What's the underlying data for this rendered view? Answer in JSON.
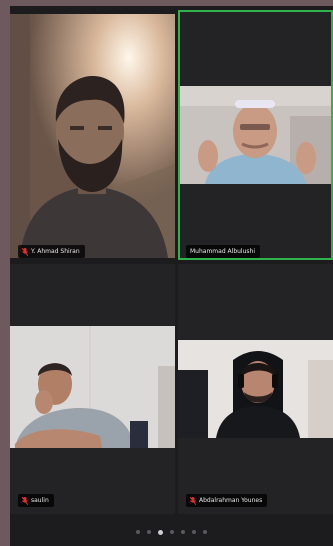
{
  "participants": [
    {
      "name": "Y. Ahmad Shiran",
      "muted": true
    },
    {
      "name": "Muhammad Albulushi",
      "muted": false
    },
    {
      "name": "saulin",
      "muted": true
    },
    {
      "name": "Abdalrahman Younes",
      "muted": true
    }
  ],
  "pagination": {
    "total": 7,
    "current": 3
  },
  "colors": {
    "active_speaker": "#2fb34a",
    "muted_icon": "#e0302a"
  }
}
